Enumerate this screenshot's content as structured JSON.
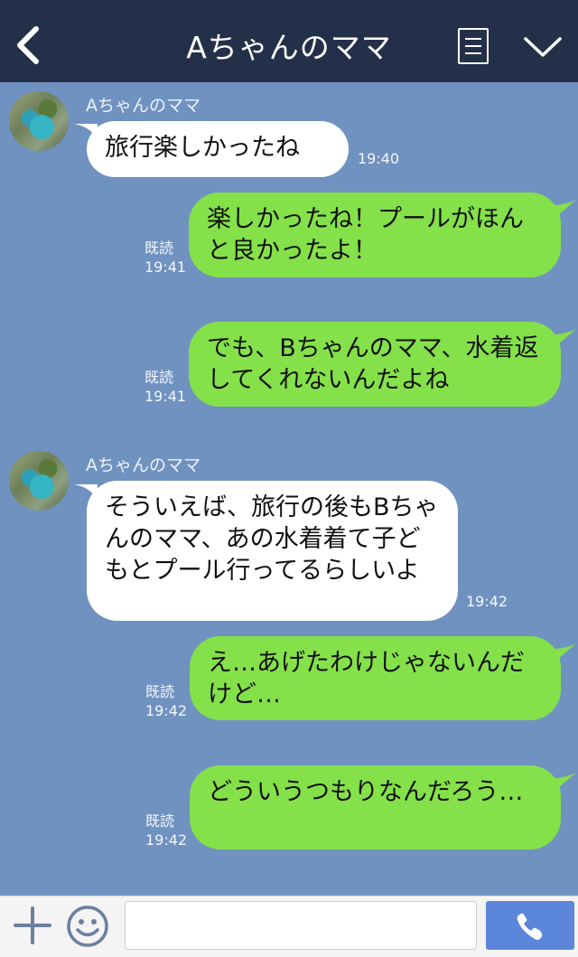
{
  "header": {
    "title": "Aちゃんのママ"
  },
  "messages": [
    {
      "type": "in",
      "sender": "Aちゃんのママ",
      "text": "旅行楽しかったね",
      "time": "19:40"
    },
    {
      "type": "out",
      "read": "既読",
      "text": "楽しかったね！プールがほんと良かったよ！",
      "time": "19:41"
    },
    {
      "type": "out",
      "read": "既読",
      "text": "でも、Bちゃんのママ、水着返してくれないんだよね",
      "time": "19:41"
    },
    {
      "type": "in",
      "sender": "Aちゃんのママ",
      "text": "そういえば、旅行の後もBちゃんのママ、あの水着着て子どもとプール行ってるらしいよ",
      "time": "19:42"
    },
    {
      "type": "out",
      "read": "既読",
      "text": "え…あげたわけじゃないんだけど…",
      "time": "19:42"
    },
    {
      "type": "out",
      "read": "既読",
      "text": "どういうつもりなんだろう…",
      "time": "19:42"
    }
  ],
  "input": {
    "placeholder": ""
  },
  "icons": {
    "back": "chevron-left-icon",
    "menu": "menu-icon",
    "collapse": "chevron-down-icon",
    "add": "plus-icon",
    "emoji": "smile-icon",
    "call": "phone-icon"
  },
  "colors": {
    "header": "#243049",
    "chat_background": "#7092c0",
    "outgoing_bubble": "#85e14a",
    "incoming_bubble": "#ffffff",
    "send_button": "#5b86d9"
  }
}
